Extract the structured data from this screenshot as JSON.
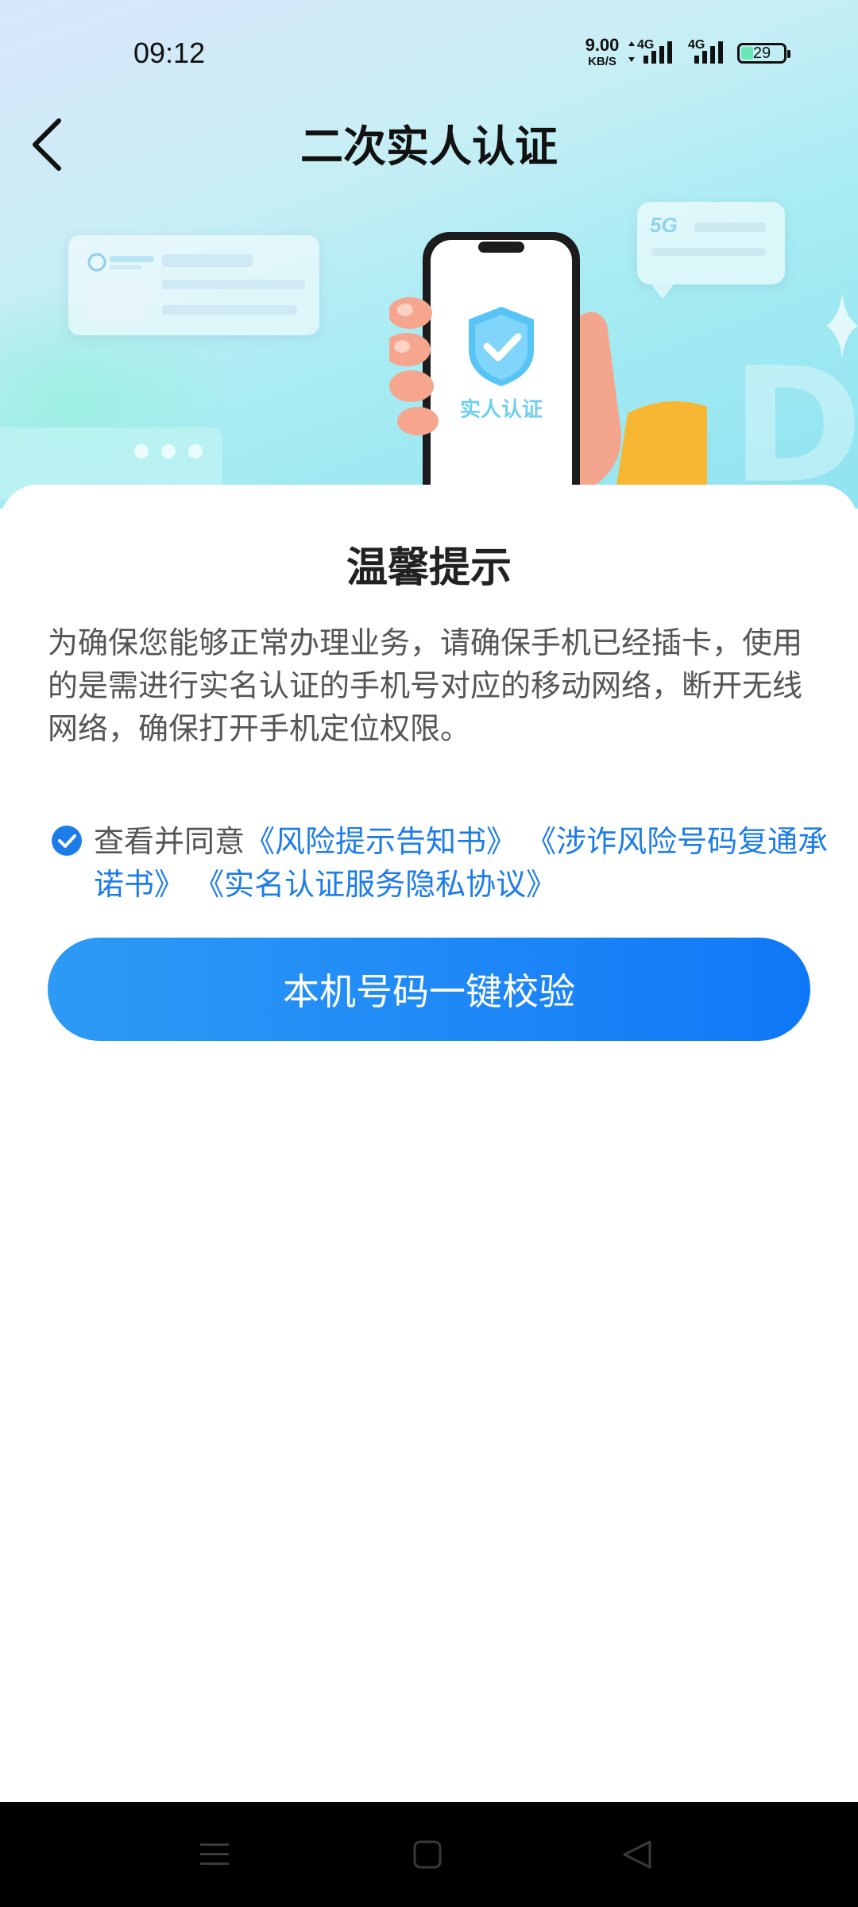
{
  "status_bar": {
    "time": "09:12",
    "net_speed_value": "9.00",
    "net_speed_unit": "KB/S",
    "sim1_type": "4G",
    "sim2_type": "4G",
    "battery_level": "29"
  },
  "header": {
    "title": "二次实人认证",
    "back_icon": "chevron-left-icon"
  },
  "hero": {
    "phone_badge": "实人认证",
    "bubble_badge": "5G"
  },
  "notice": {
    "title": "温馨提示",
    "body": "为确保您能够正常办理业务，请确保手机已经插卡，使用的是需进行实名认证的手机号对应的移动网络，断开无线网络，确保打开手机定位权限。"
  },
  "agreement": {
    "checked": true,
    "prefix": "查看并同意",
    "link1": "《风险提示告知书》",
    "link2": "《涉诈风险号码复通承诺书》",
    "link3": "《实名认证服务隐私协议》"
  },
  "verify_button": {
    "label": "本机号码一键校验"
  },
  "nav_bar": {
    "menu_icon": "menu-icon",
    "home_icon": "home-square-icon",
    "back_icon": "back-triangle-icon"
  },
  "colors": {
    "accent": "#1c7ce8",
    "button_start": "#2d9bf5",
    "button_end": "#0f78f7"
  }
}
